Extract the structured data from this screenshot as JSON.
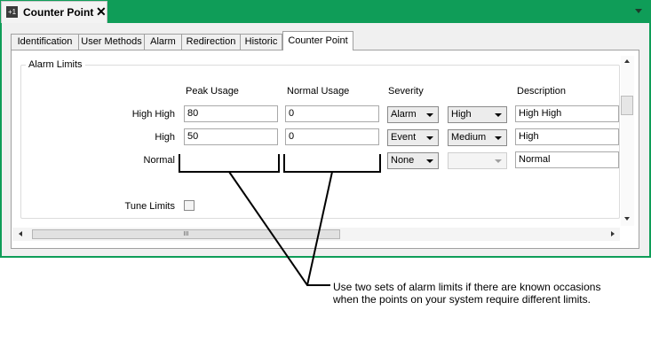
{
  "document_tab": {
    "icon_text": "+1",
    "title": "Counter Point",
    "close": "✕"
  },
  "tabs": [
    {
      "label": "Identification"
    },
    {
      "label": "User Methods"
    },
    {
      "label": "Alarm"
    },
    {
      "label": "Redirection"
    },
    {
      "label": "Historic"
    },
    {
      "label": "Counter Point"
    }
  ],
  "active_tab": "Counter Point",
  "alarm_limits": {
    "group_label": "Alarm Limits",
    "columns": {
      "peak": "Peak Usage",
      "normal": "Normal Usage",
      "severity": "Severity",
      "description": "Description"
    },
    "rows": [
      {
        "label": "High High",
        "peak": "80",
        "normal": "0",
        "severity": "Alarm",
        "level": "High",
        "description": "High High"
      },
      {
        "label": "High",
        "peak": "50",
        "normal": "0",
        "severity": "Event",
        "level": "Medium",
        "description": "High"
      },
      {
        "label": "Normal",
        "peak": "",
        "normal": "",
        "severity": "None",
        "level": "",
        "description": "Normal"
      }
    ],
    "tune_limits_label": "Tune Limits",
    "tune_limits_checked": false
  },
  "scrollbar": {
    "thumb_text": "III"
  },
  "callout": "Use two sets of alarm limits if there are known occasions when the points on your system require different limits.",
  "colors": {
    "accent": "#0f9d58"
  }
}
